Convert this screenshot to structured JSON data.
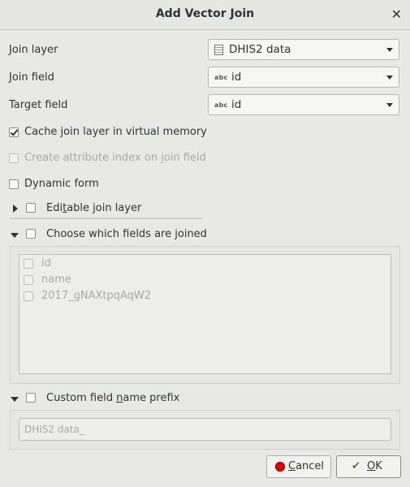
{
  "window": {
    "title": "Add Vector Join"
  },
  "join_layer": {
    "label": "Join layer",
    "value": "DHIS2 data",
    "icon": "table-icon"
  },
  "join_field": {
    "label": "Join field",
    "value": "id",
    "type_badge": "abc"
  },
  "target_field": {
    "label": "Target field",
    "value": "id",
    "type_badge": "abc"
  },
  "options": {
    "cache": {
      "label": "Cache join layer in virtual memory",
      "checked": true
    },
    "index": {
      "label": "Create attribute index on join field",
      "checked": false,
      "enabled": false
    },
    "dynamic": {
      "label": "Dynamic form",
      "checked": false
    }
  },
  "editable": {
    "pre": "Edi",
    "u": "t",
    "post": "able join layer",
    "expanded": false,
    "checked": false
  },
  "fields_group": {
    "pre": "Choose which fields are ",
    "u": "j",
    "post": "oined",
    "expanded": true,
    "checked": false,
    "fields": [
      "id",
      "name",
      "2017_gNAXtpqAqW2"
    ]
  },
  "prefix_group": {
    "pre": "Custom field ",
    "u": "n",
    "post": "ame prefix",
    "expanded": true,
    "checked": false,
    "value": "DHIS2 data_"
  },
  "buttons": {
    "cancel": {
      "u": "C",
      "post": "ancel"
    },
    "ok": {
      "u": "O",
      "post": "K"
    }
  }
}
